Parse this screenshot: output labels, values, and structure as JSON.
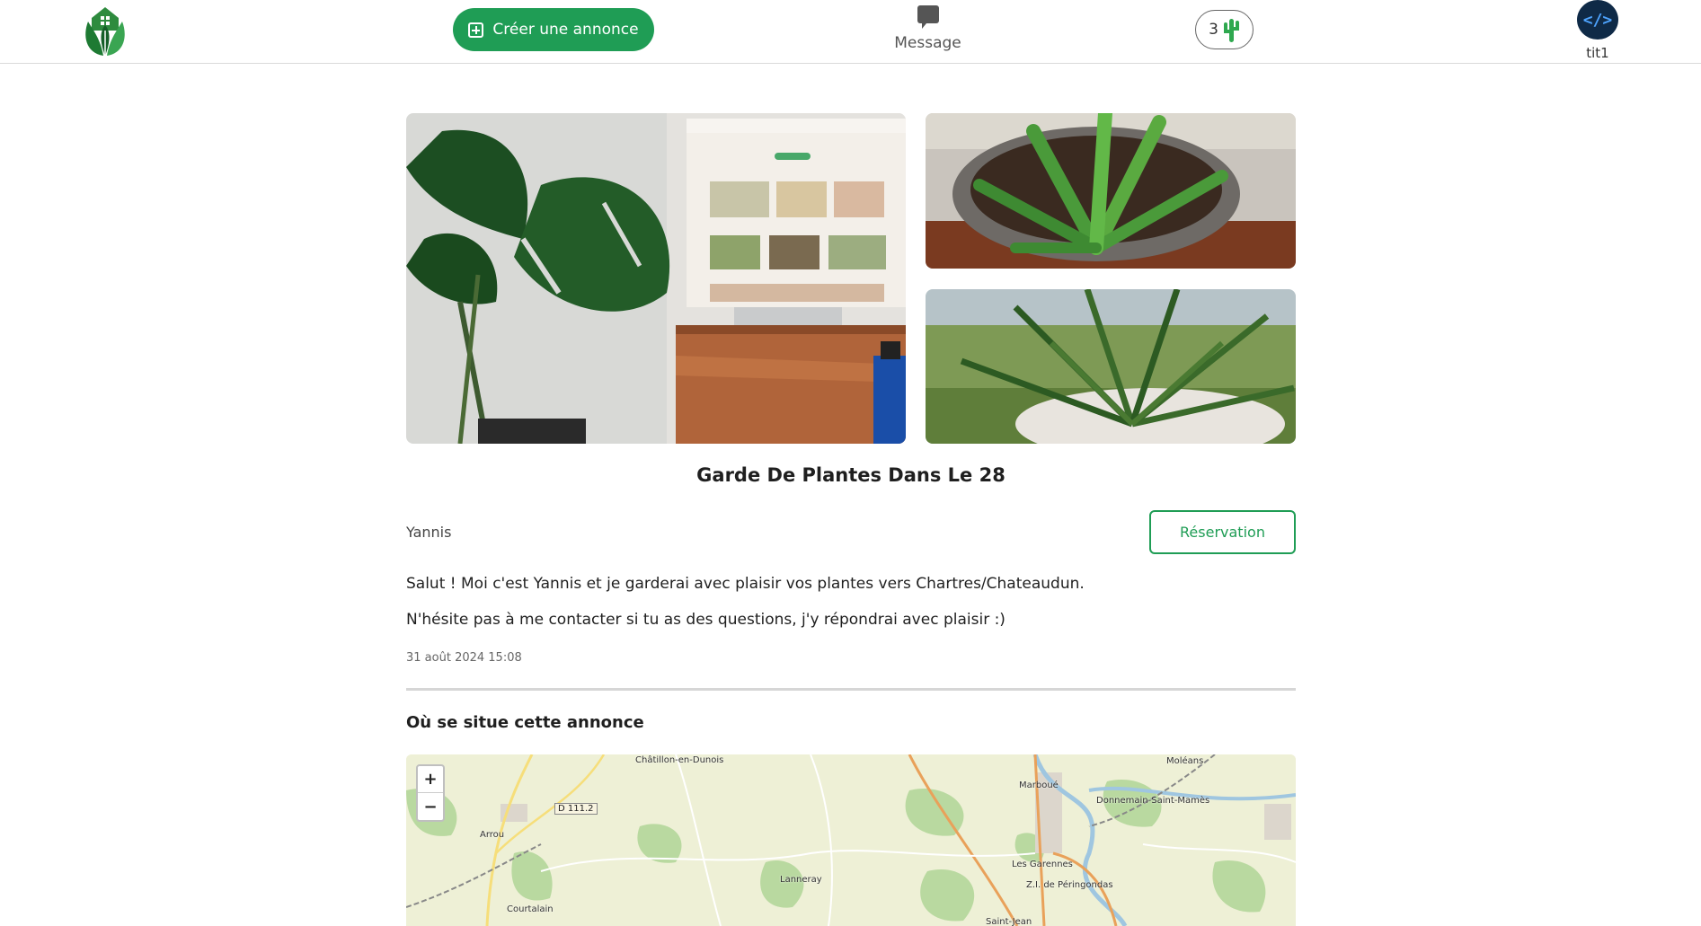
{
  "header": {
    "create_label": "Créer une annonce",
    "message_label": "Message",
    "points_value": "3",
    "username": "tit1",
    "avatar_text": "</>"
  },
  "listing": {
    "title": "Garde De Plantes Dans Le 28",
    "author": "Yannis",
    "reserve_label": "Réservation",
    "description": [
      "Salut ! Moi c'est Yannis et je garderai avec plaisir vos plantes vers Chartres/Chateaudun.",
      "N'hésite pas à me contacter si tu as des questions, j'y répondrai avec plaisir :)"
    ],
    "date": "31 août 2024 15:08"
  },
  "location": {
    "title": "Où se situe cette annonce",
    "zoom_in": "+",
    "zoom_out": "−",
    "places": [
      "Châtillon-en-Dunois",
      "D 111.2",
      "Arrou",
      "Courtalain",
      "Lanneray",
      "Marboué",
      "Les Garennes",
      "Z.I. de Péringondas",
      "Saint-Jean",
      "Moléans",
      "Donnemain-Saint-Mamès"
    ]
  },
  "colors": {
    "brand_green": "#1f9d55",
    "map_background": "#eef0d6"
  }
}
